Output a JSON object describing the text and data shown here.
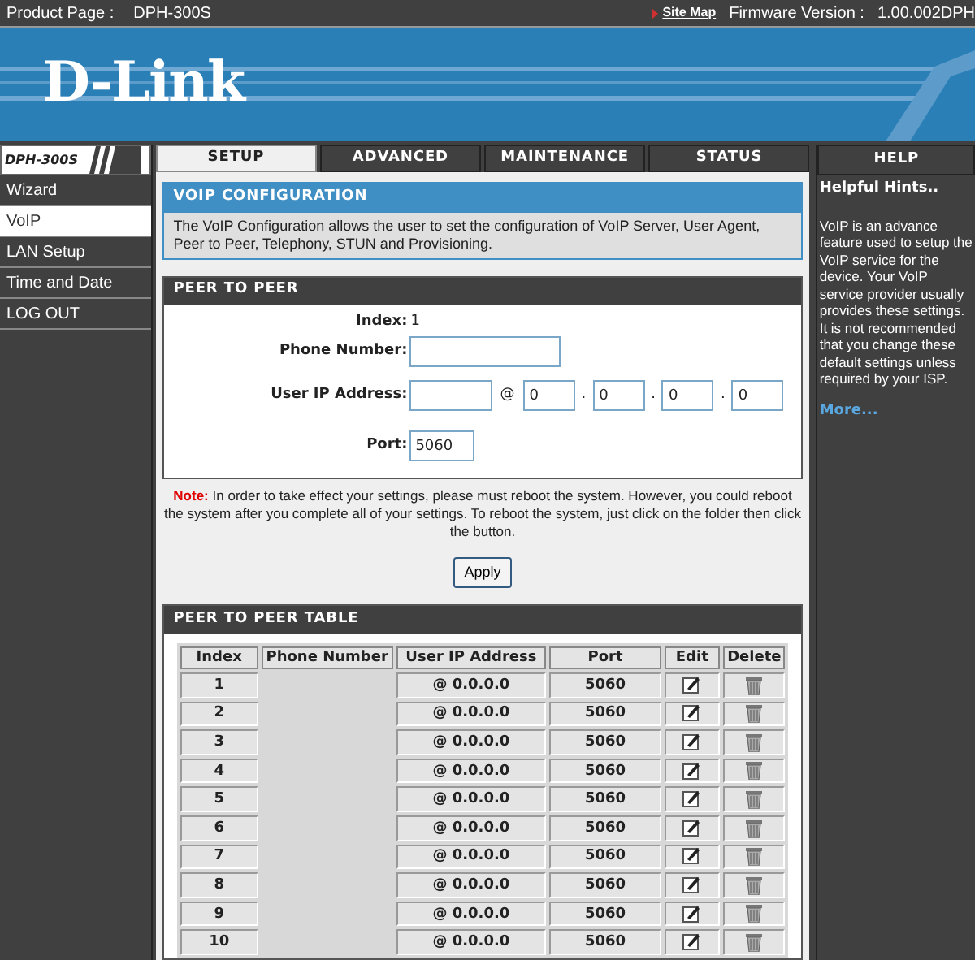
{
  "top_bar": {
    "product_label": "Product Page :",
    "product": "DPH-300S",
    "site_map": "Site Map",
    "firmware_label": "Firmware Version :",
    "firmware": "1.00.002DPH"
  },
  "logo": "D-Link",
  "model_badge": "DPH-300S",
  "tabs": [
    {
      "label": "SETUP",
      "selected": true
    },
    {
      "label": "ADVANCED",
      "selected": false
    },
    {
      "label": "MAINTENANCE",
      "selected": false
    },
    {
      "label": "STATUS",
      "selected": false
    }
  ],
  "help_tab": "HELP",
  "sidebar": {
    "items": [
      {
        "label": "Wizard",
        "selected": false
      },
      {
        "label": "VoIP",
        "selected": true
      },
      {
        "label": "LAN Setup",
        "selected": false
      },
      {
        "label": "Time and Date",
        "selected": false
      },
      {
        "label": "LOG OUT",
        "selected": false
      }
    ]
  },
  "voip_config": {
    "title": "VOIP CONFIGURATION",
    "description": "The VoIP Configuration allows the user to set the configuration of VoIP Server, User Agent, Peer to Peer, Telephony, STUN and Provisioning."
  },
  "peer_to_peer": {
    "title": "PEER TO PEER",
    "index_label": "Index:",
    "index_value": "1",
    "phone_label": "Phone Number:",
    "ip_label": "User IP Address:",
    "ip_at": "@",
    "ip_octets": [
      "0",
      "0",
      "0",
      "0"
    ],
    "ip_separator": ".",
    "port_label": "Port:",
    "port_value": "5060"
  },
  "note": {
    "label": "Note:",
    "text": "In order to take effect your settings, please must reboot the system. However, you could reboot the system after you complete all of your settings. To reboot the system, just click on the folder then click the button."
  },
  "apply_button": "Apply",
  "peer_table": {
    "title": "PEER TO PEER TABLE",
    "columns": [
      "Index",
      "Phone Number",
      "User IP Address",
      "Port",
      "Edit",
      "Delete"
    ],
    "rows": [
      {
        "index": "1",
        "ip": "@ 0.0.0.0",
        "port": "5060"
      },
      {
        "index": "2",
        "ip": "@ 0.0.0.0",
        "port": "5060"
      },
      {
        "index": "3",
        "ip": "@ 0.0.0.0",
        "port": "5060"
      },
      {
        "index": "4",
        "ip": "@ 0.0.0.0",
        "port": "5060"
      },
      {
        "index": "5",
        "ip": "@ 0.0.0.0",
        "port": "5060"
      },
      {
        "index": "6",
        "ip": "@ 0.0.0.0",
        "port": "5060"
      },
      {
        "index": "7",
        "ip": "@ 0.0.0.0",
        "port": "5060"
      },
      {
        "index": "8",
        "ip": "@ 0.0.0.0",
        "port": "5060"
      },
      {
        "index": "9",
        "ip": "@ 0.0.0.0",
        "port": "5060"
      },
      {
        "index": "10",
        "ip": "@ 0.0.0.0",
        "port": "5060"
      }
    ]
  },
  "help": {
    "title": "Helpful Hints..",
    "text": "VoIP is an advance feature used to setup the VoIP service for the device. Your VoIP service provider usually provides these settings. It is not recommended that you change these default settings unless required by your ISP.",
    "more": "More..."
  }
}
